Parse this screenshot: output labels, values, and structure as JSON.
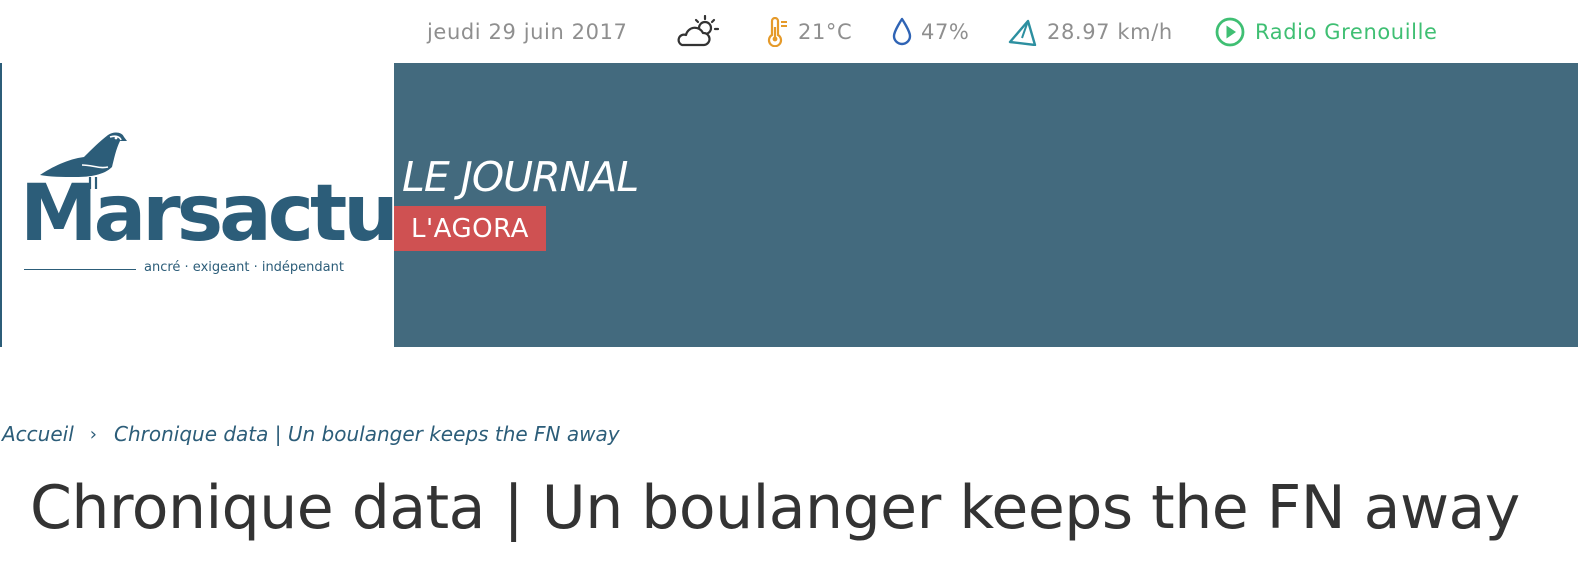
{
  "colors": {
    "brand": "#2c5d79",
    "banner": "#436a7e",
    "tag": "#cf5152",
    "radio": "#3fbf73",
    "thermometer": "#e59a2a",
    "droplet": "#2f64b5",
    "wind": "#2c8fa0",
    "meta_text": "#8f8f8f",
    "headline": "#333333"
  },
  "topbar": {
    "date": "jeudi 29 juin 2017",
    "weather_icon": "partly-cloudy-sun-icon",
    "temperature": "21°C",
    "temperature_icon": "thermometer-icon",
    "humidity": "47%",
    "humidity_icon": "droplet-icon",
    "wind": "28.97 km/h",
    "wind_icon": "wind-direction-arrow-icon",
    "radio_label": "Radio Grenouille",
    "radio_icon": "play-circle-icon"
  },
  "logo": {
    "name": "Marsactu",
    "tagline": "ancré · exigeant · indépendant",
    "icon": "seagull-icon"
  },
  "banner": {
    "title": "LE JOURNAL",
    "section_tag": "L'AGORA"
  },
  "breadcrumb": {
    "home": "Accueil",
    "separator": "›",
    "current": "Chronique data | Un boulanger keeps the FN away"
  },
  "article": {
    "title": "Chronique data | Un boulanger keeps the FN away"
  }
}
